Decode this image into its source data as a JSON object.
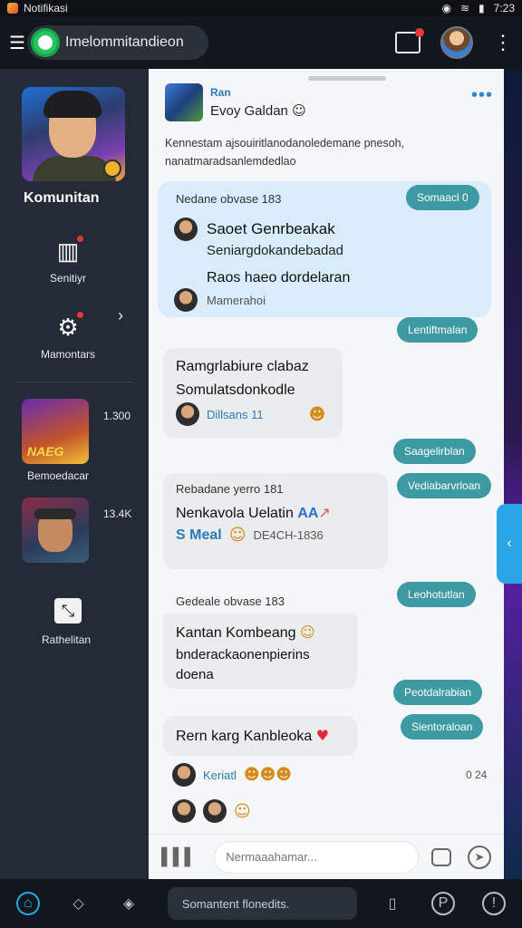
{
  "status_bar": {
    "app_name": "Notifikasi",
    "time": "7:23"
  },
  "app_bar": {
    "search_text": "Imelommitandieon",
    "menu_glyph": "☰",
    "kebab_glyph": "⋮"
  },
  "sidebar": {
    "title": "Komunitan",
    "items": [
      {
        "label": "Senitiyr",
        "icon": "grid-icon"
      },
      {
        "label": "Mamontars",
        "icon": "gear-icon"
      }
    ],
    "games": [
      {
        "label": "Bemoedacar",
        "count": "1.300",
        "tag": "NAEG"
      },
      {
        "label": "",
        "count": "13.4K"
      }
    ],
    "analytics_label": "Rathelitan"
  },
  "post": {
    "user": "Ran",
    "subtitle": "Evoy Galdan",
    "body_line1": "Kennestam ajsouiritlanodanoledemane pnesoh,",
    "body_line2": "nanatmaradsanlemdedlao"
  },
  "thread": {
    "title": "Nedane obvase 183",
    "badge": "Somaacl 0",
    "line1": "Saoet Genrbeakak",
    "line2": "Seniargdokandebadad",
    "line3": "Raos haeo dordelaran",
    "meta": "Mamerahoi"
  },
  "pills": [
    "Lentiftmalan",
    "Saagelirblan",
    "Vediabarvrloan",
    "Leohotutlan",
    "Peotdalrabian",
    "Sientoraloan"
  ],
  "messages": [
    {
      "line1": "Ramgrlabiure clabaz",
      "line2": "Somulatsdonkodle",
      "meta": "Dillsans 11"
    },
    {
      "title": "Rebadane yerro 181",
      "line1": "Nenkavola Uelatin",
      "meta_lead": "S Meal",
      "meta_tail": "DE4CH-1836"
    },
    {
      "title": "Gedeale obvase 183",
      "line1": "Kantan Kombeang",
      "line2": "bnderackaonenpierins",
      "line3": "doena"
    },
    {
      "line1": "Rern karg Kanbleoka"
    }
  ],
  "reaction": {
    "name": "Keriatl",
    "time": "0 24"
  },
  "composer": {
    "placeholder": "Nermaaahamar..."
  },
  "bottom_nav": {
    "search_text": "Somantent flonedits."
  },
  "colors": {
    "accent": "#3d9aa3",
    "link": "#2b7bb9",
    "thread_bg": "#d8ecfb",
    "sidebar_bg": "#242b36"
  }
}
